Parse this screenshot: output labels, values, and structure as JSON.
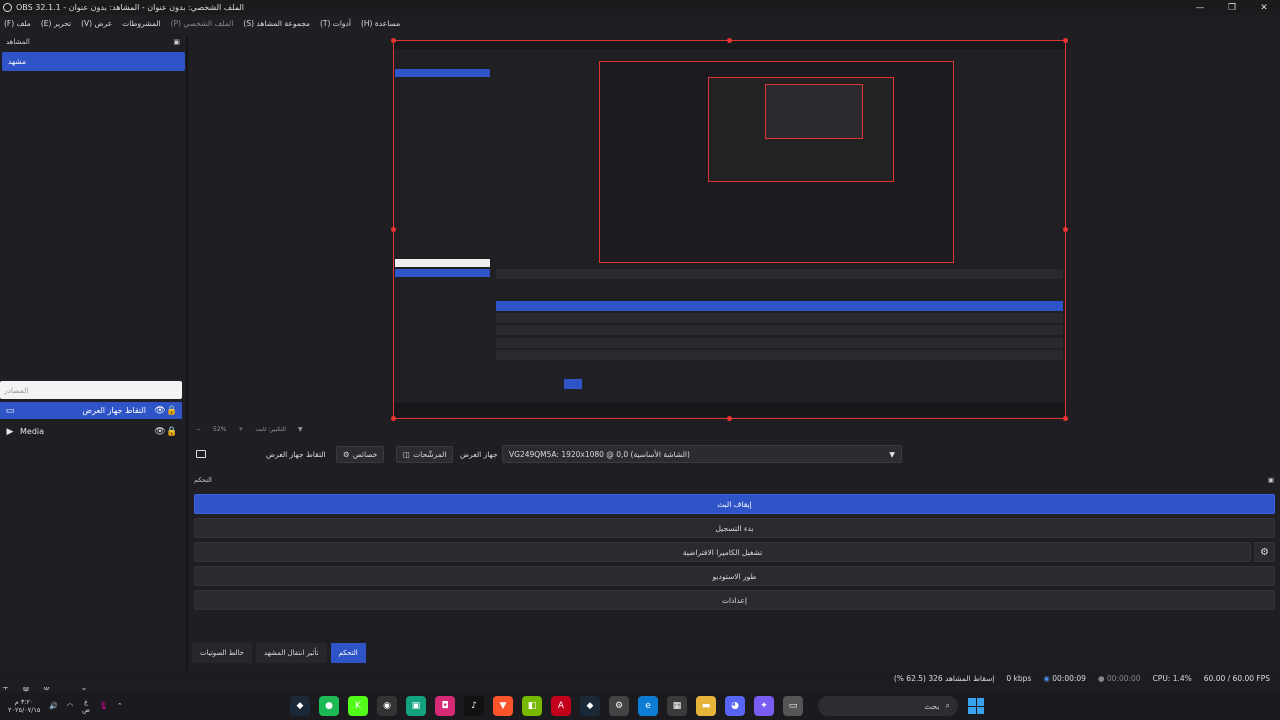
{
  "window": {
    "title": "OBS 32.1.1 - الملف الشخصي: بدون عنوان - المشاهد: بدون عنوان"
  },
  "menu": [
    {
      "label": "(F) ملف",
      "dim": false
    },
    {
      "label": "(E) تحرير",
      "dim": false
    },
    {
      "label": "(V) عرض",
      "dim": false
    },
    {
      "label": "المشروطات",
      "dim": false
    },
    {
      "label": "(P) الملف الشخصي",
      "dim": true
    },
    {
      "label": "(S) مجموعة المشاهد",
      "dim": false
    },
    {
      "label": "(T) أدوات",
      "dim": false
    },
    {
      "label": "(H) مساعدة",
      "dim": false
    }
  ],
  "scenes": {
    "header": "المشاهد",
    "items": [
      "مشهد"
    ]
  },
  "sources": {
    "header": "المصادر",
    "items": [
      {
        "name": "التقاط جهاز العرض",
        "type": "monitor"
      },
      {
        "name": "Media",
        "type": "media"
      }
    ]
  },
  "zoom": {
    "percent": "52%",
    "plus": "+",
    "minus": "−",
    "mode": "التكبير: ثابت"
  },
  "source_toolbar": {
    "name": "التقاط جهاز العرض",
    "properties": "خصائص",
    "filters": "المرشّحات",
    "display_label": "جهاز العرض",
    "display_value": "VG249QM5A: 1920x1080 @ 0,0 (الشاشة الأساسية)"
  },
  "controls": {
    "header": "التحكم",
    "buttons": [
      "إيقاف البث",
      "بدء التسجيل",
      "تشغيل الكاميرا الافتراضية",
      "طور الاستوديو",
      "إعدادات"
    ],
    "active_index": 0
  },
  "tabs": {
    "items": [
      "التحكم",
      "تأثير انتقال المشهد",
      "خالط الصوتيات"
    ],
    "active_index": 0
  },
  "status": {
    "dropped": "إسقاط المشاهد 326 (62.5 %)",
    "bitrate": "0 kbps",
    "stream_time": "00:00:09",
    "rec_time": "00:00:00",
    "cpu": "CPU: 1.4%",
    "fps": "60.00 / 60.00 FPS"
  },
  "taskbar": {
    "clock_time": "٣:٢٠ م",
    "clock_date": "٢٠٢٥/٠٧/١٥",
    "search_placeholder": "بحث",
    "lang": "ع",
    "lang_sub": "ض",
    "apps": [
      {
        "icon": "steam-icon",
        "color": "#1b2838",
        "glyph": "◆"
      },
      {
        "icon": "spotify-icon",
        "color": "#1db954",
        "glyph": "●"
      },
      {
        "icon": "kick-icon",
        "color": "#53fc18",
        "glyph": "K"
      },
      {
        "icon": "obs-icon",
        "color": "#333",
        "glyph": "◉"
      },
      {
        "icon": "app-green-icon",
        "color": "#14a37f",
        "glyph": "▣"
      },
      {
        "icon": "instagram-icon",
        "color": "#d62976",
        "glyph": "◘"
      },
      {
        "icon": "tiktok-icon",
        "color": "#111",
        "glyph": "♪"
      },
      {
        "icon": "brave-icon",
        "color": "#fb542b",
        "glyph": "▼"
      },
      {
        "icon": "nvidia-icon",
        "color": "#76b900",
        "glyph": "◧"
      },
      {
        "icon": "adobe-icon",
        "color": "#c2001b",
        "glyph": "A"
      },
      {
        "icon": "steam2-icon",
        "color": "#1b2838",
        "glyph": "◆"
      },
      {
        "icon": "settings-app-icon",
        "color": "#444",
        "glyph": "⚙"
      },
      {
        "icon": "edge-icon",
        "color": "#0c7cd5",
        "glyph": "e"
      },
      {
        "icon": "store-icon",
        "color": "#3a3a3a",
        "glyph": "▦"
      },
      {
        "icon": "folder-icon",
        "color": "#e6b43b",
        "glyph": "▬"
      },
      {
        "icon": "discord-icon",
        "color": "#5865f2",
        "glyph": "◕"
      },
      {
        "icon": "copilot-icon",
        "color": "#7b5cf0",
        "glyph": "✦"
      },
      {
        "icon": "taskview-icon",
        "color": "#555",
        "glyph": "▭"
      }
    ]
  }
}
